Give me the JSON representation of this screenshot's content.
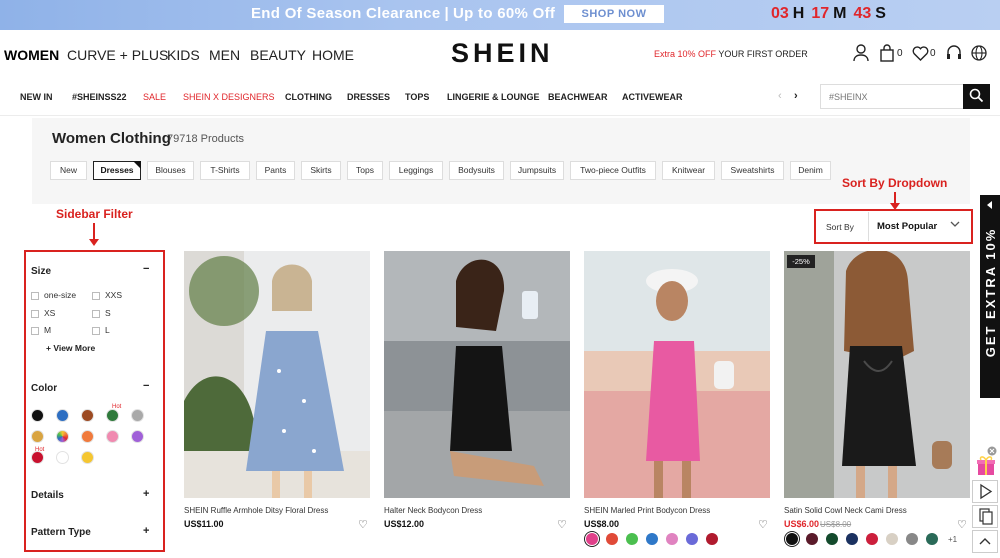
{
  "promo": {
    "text_left": "End Of Season Clearance",
    "separator": "|",
    "text_right": "Up to 60% Off",
    "cta": "SHOP NOW",
    "countdown": [
      {
        "value": "03",
        "unit": "H"
      },
      {
        "value": "17",
        "unit": "M"
      },
      {
        "value": "43",
        "unit": "S"
      }
    ]
  },
  "header": {
    "categories": [
      "WOMEN",
      "CURVE + PLUS",
      "KIDS",
      "MEN",
      "BEAUTY",
      "HOME"
    ],
    "logo": "SHEIN",
    "extra_red": "Extra 10% OFF",
    "extra_rest": " YOUR FIRST ORDER",
    "cart_count": "0",
    "wishlist_count": "0"
  },
  "nav": {
    "items": [
      "NEW IN",
      "#SHEINSS22",
      "SALE",
      "SHEIN X DESIGNERS",
      "CLOTHING",
      "DRESSES",
      "TOPS",
      "LINGERIE & LOUNGE",
      "BEACHWEAR",
      "ACTIVEWEAR"
    ],
    "prev": "‹",
    "next": "›",
    "search_placeholder": "#SHEINX"
  },
  "listing": {
    "title": "Women Clothing",
    "count": "79718 Products",
    "chips": [
      "New",
      "Dresses",
      "Blouses",
      "T-Shirts",
      "Pants",
      "Skirts",
      "Tops",
      "Leggings",
      "Bodysuits",
      "Jumpsuits",
      "Two-piece Outfits",
      "Knitwear",
      "Sweatshirts",
      "Denim"
    ],
    "active_chip": "Dresses"
  },
  "annotations": {
    "sort": "Sort By Dropdown",
    "sidebar": "Sidebar Filter"
  },
  "sort": {
    "label": "Sort By",
    "value": "Most Popular"
  },
  "sidebar": {
    "size": {
      "title": "Size",
      "toggle": "−",
      "options": [
        "one-size",
        "XXS",
        "XS",
        "S",
        "M",
        "L"
      ],
      "view_more": "+ View More"
    },
    "color": {
      "title": "Color",
      "toggle": "−",
      "hot_label": "Hot",
      "swatches": [
        "#111111",
        "#2e6fc2",
        "#9c4a22",
        "#2f7a3b",
        "#a9a9a9",
        "#d9a441",
        "multi",
        "#f07a3c",
        "#f08ab0",
        "#a060d8",
        "#c8102e",
        "#ffffff",
        "#f5c631"
      ]
    },
    "details": {
      "title": "Details",
      "toggle": "+"
    },
    "pattern": {
      "title": "Pattern Type",
      "toggle": "+"
    }
  },
  "products": [
    {
      "title": "SHEIN Ruffle Armhole Ditsy Floral Dress",
      "price": "US$11.00",
      "colors": []
    },
    {
      "title": "Halter Neck Bodycon Dress",
      "price": "US$12.00",
      "colors": []
    },
    {
      "title": "SHEIN Marled Print Bodycon Dress",
      "price": "US$8.00",
      "colors": [
        "#e0408a",
        "#e04a38",
        "#4bbf4f",
        "#2f78c8",
        "#e083c0",
        "#6a6ad8",
        "#b01a2e"
      ]
    },
    {
      "title": "Satin Solid Cowl Neck Cami Dress",
      "price": "US$6.00",
      "old_price": "US$8.00",
      "discount": "-25%",
      "colors": [
        "#111111",
        "#5a1a2a",
        "#134a2c",
        "#1b3160",
        "#cc1f3c",
        "#d8d0c4",
        "#888888",
        "#2a6a58"
      ],
      "more": "+1"
    }
  ],
  "rail": {
    "get_extra": "GET EXTRA 10%"
  }
}
